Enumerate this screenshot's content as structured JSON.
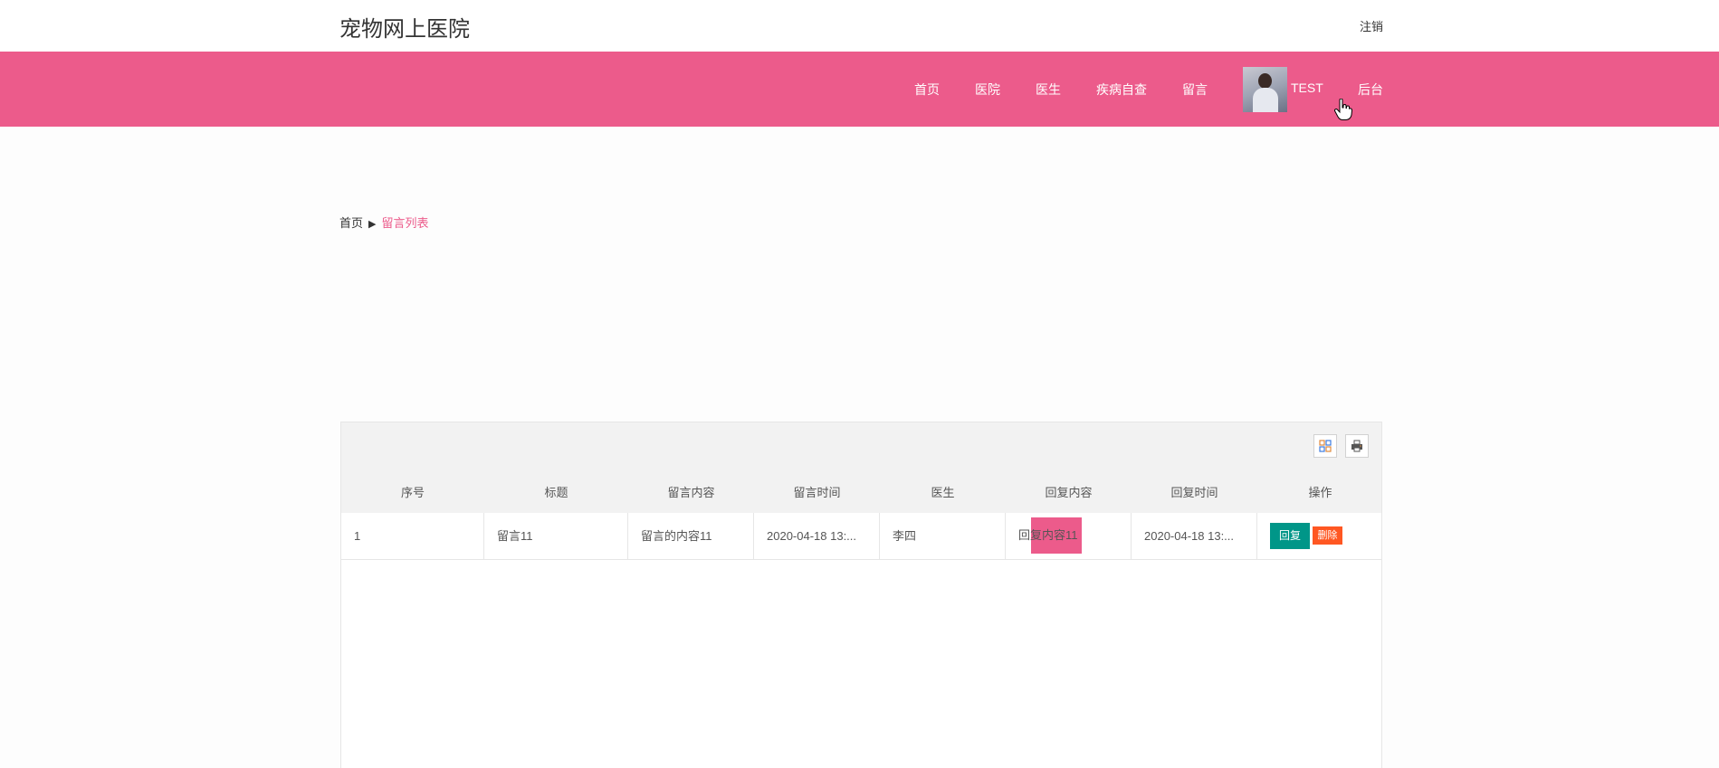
{
  "header": {
    "site_title": "宠物网上医院",
    "logout_label": "注销"
  },
  "nav": {
    "items": [
      "首页",
      "医院",
      "医生",
      "疾病自查",
      "留言"
    ],
    "username": "TEST",
    "admin_label": "后台",
    "bg_color": "#ec5b8b"
  },
  "breadcrumb": {
    "home": "首页",
    "separator": "▶",
    "current": "留言列表"
  },
  "toolbar": {
    "icons": [
      "columns-filter-icon",
      "print-icon"
    ]
  },
  "table": {
    "columns": [
      "序号",
      "标题",
      "留言内容",
      "留言时间",
      "医生",
      "回复内容",
      "回复时间",
      "操作"
    ],
    "rows": [
      {
        "index": "1",
        "title": "留言11",
        "content": "留言的内容11",
        "time": "2020-04-18 13:...",
        "doctor": "李四",
        "reply": "回复内容11",
        "reply_time": "2020-04-18 13:...",
        "action_reply": "回复",
        "action_delete": "删除"
      }
    ]
  }
}
